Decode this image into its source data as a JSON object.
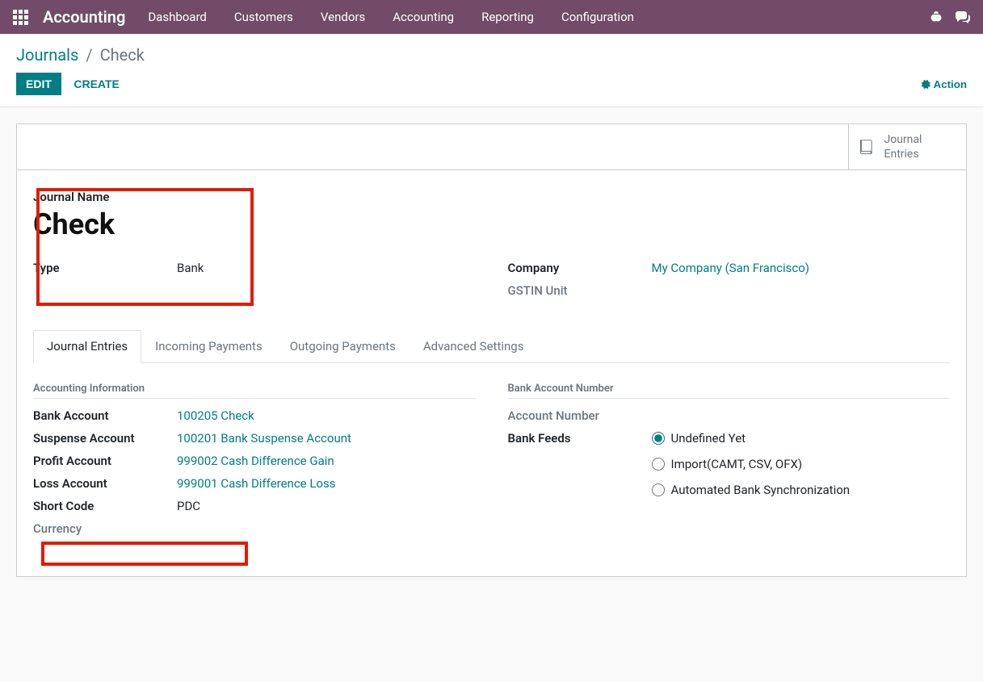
{
  "navbar": {
    "brand": "Accounting",
    "menu": [
      "Dashboard",
      "Customers",
      "Vendors",
      "Accounting",
      "Reporting",
      "Configuration"
    ]
  },
  "breadcrumb": {
    "root": "Journals",
    "current": "Check"
  },
  "buttons": {
    "edit": "EDIT",
    "create": "CREATE",
    "action": "Action"
  },
  "stat": {
    "journal_entries": "Journal Entries"
  },
  "header": {
    "name_label": "Journal Name",
    "name_value": "Check",
    "type_label": "Type",
    "type_value": "Bank",
    "company_label": "Company",
    "company_value": "My Company (San Francisco)",
    "gstin_label": "GSTIN Unit"
  },
  "tabs": {
    "t1": "Journal Entries",
    "t2": "Incoming Payments",
    "t3": "Outgoing Payments",
    "t4": "Advanced Settings"
  },
  "left_section": {
    "title": "Accounting Information",
    "rows": {
      "bank_account_label": "Bank Account",
      "bank_account_value": "100205 Check",
      "suspense_label": "Suspense Account",
      "suspense_value": "100201 Bank Suspense Account",
      "profit_label": "Profit Account",
      "profit_value": "999002 Cash Difference Gain",
      "loss_label": "Loss Account",
      "loss_value": "999001 Cash Difference Loss",
      "short_code_label": "Short Code",
      "short_code_value": "PDC",
      "currency_label": "Currency"
    }
  },
  "right_section": {
    "bank_number_title": "Bank Account Number",
    "account_number_label": "Account Number",
    "feeds_label": "Bank Feeds",
    "radio": {
      "r1": "Undefined Yet",
      "r2": "Import(CAMT, CSV, OFX)",
      "r3": "Automated Bank Synchronization"
    }
  }
}
